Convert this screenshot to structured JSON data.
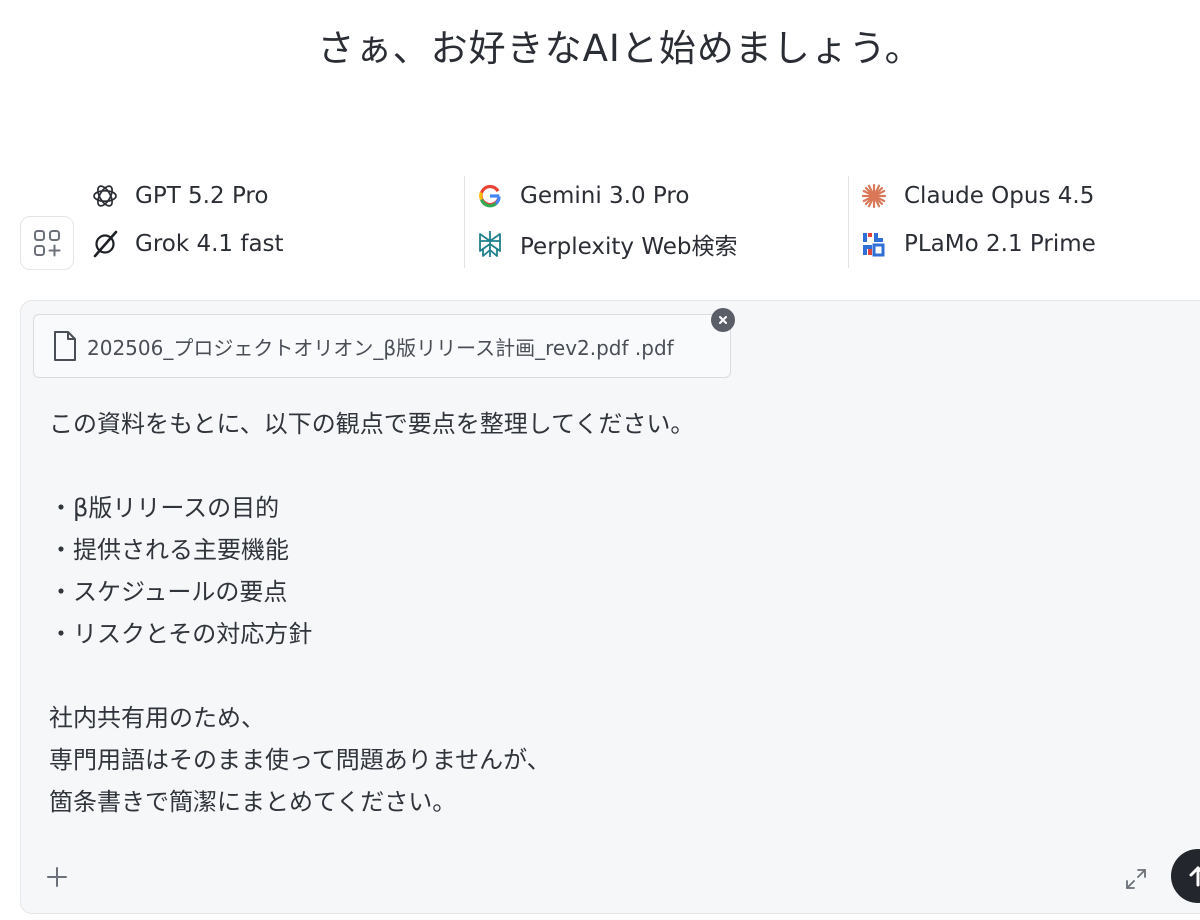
{
  "heading": "さぁ、お好きなAIと始めましょう。",
  "models": [
    {
      "label": "GPT 5.2 Pro",
      "icon": "openai-icon"
    },
    {
      "label": "Grok 4.1 fast",
      "icon": "grok-icon"
    },
    {
      "label": "Gemini 3.0 Pro",
      "icon": "google-icon"
    },
    {
      "label": "Perplexity Web検索",
      "icon": "perplexity-icon"
    },
    {
      "label": "Claude Opus 4.5",
      "icon": "claude-icon"
    },
    {
      "label": "PLaMo 2.1 Prime",
      "icon": "plamo-icon"
    }
  ],
  "attachment": {
    "filename": "202506_プロジェクトオリオン_β版リリース計画_rev2.pdf .pdf"
  },
  "message": {
    "lines": [
      "この資料をもとに、以下の観点で要点を整理してください。",
      "",
      "・β版リリースの目的",
      "・提供される主要機能",
      "・スケジュールの要点",
      "・リスクとその対応方針",
      "",
      "社内共有用のため、",
      "専門用語はそのまま使って問題ありませんが、",
      "箇条書きで簡潔にまとめてください。"
    ]
  },
  "colors": {
    "claude": "#d97757",
    "send_button": "#23272d",
    "input_background": "#f6f7f9"
  }
}
